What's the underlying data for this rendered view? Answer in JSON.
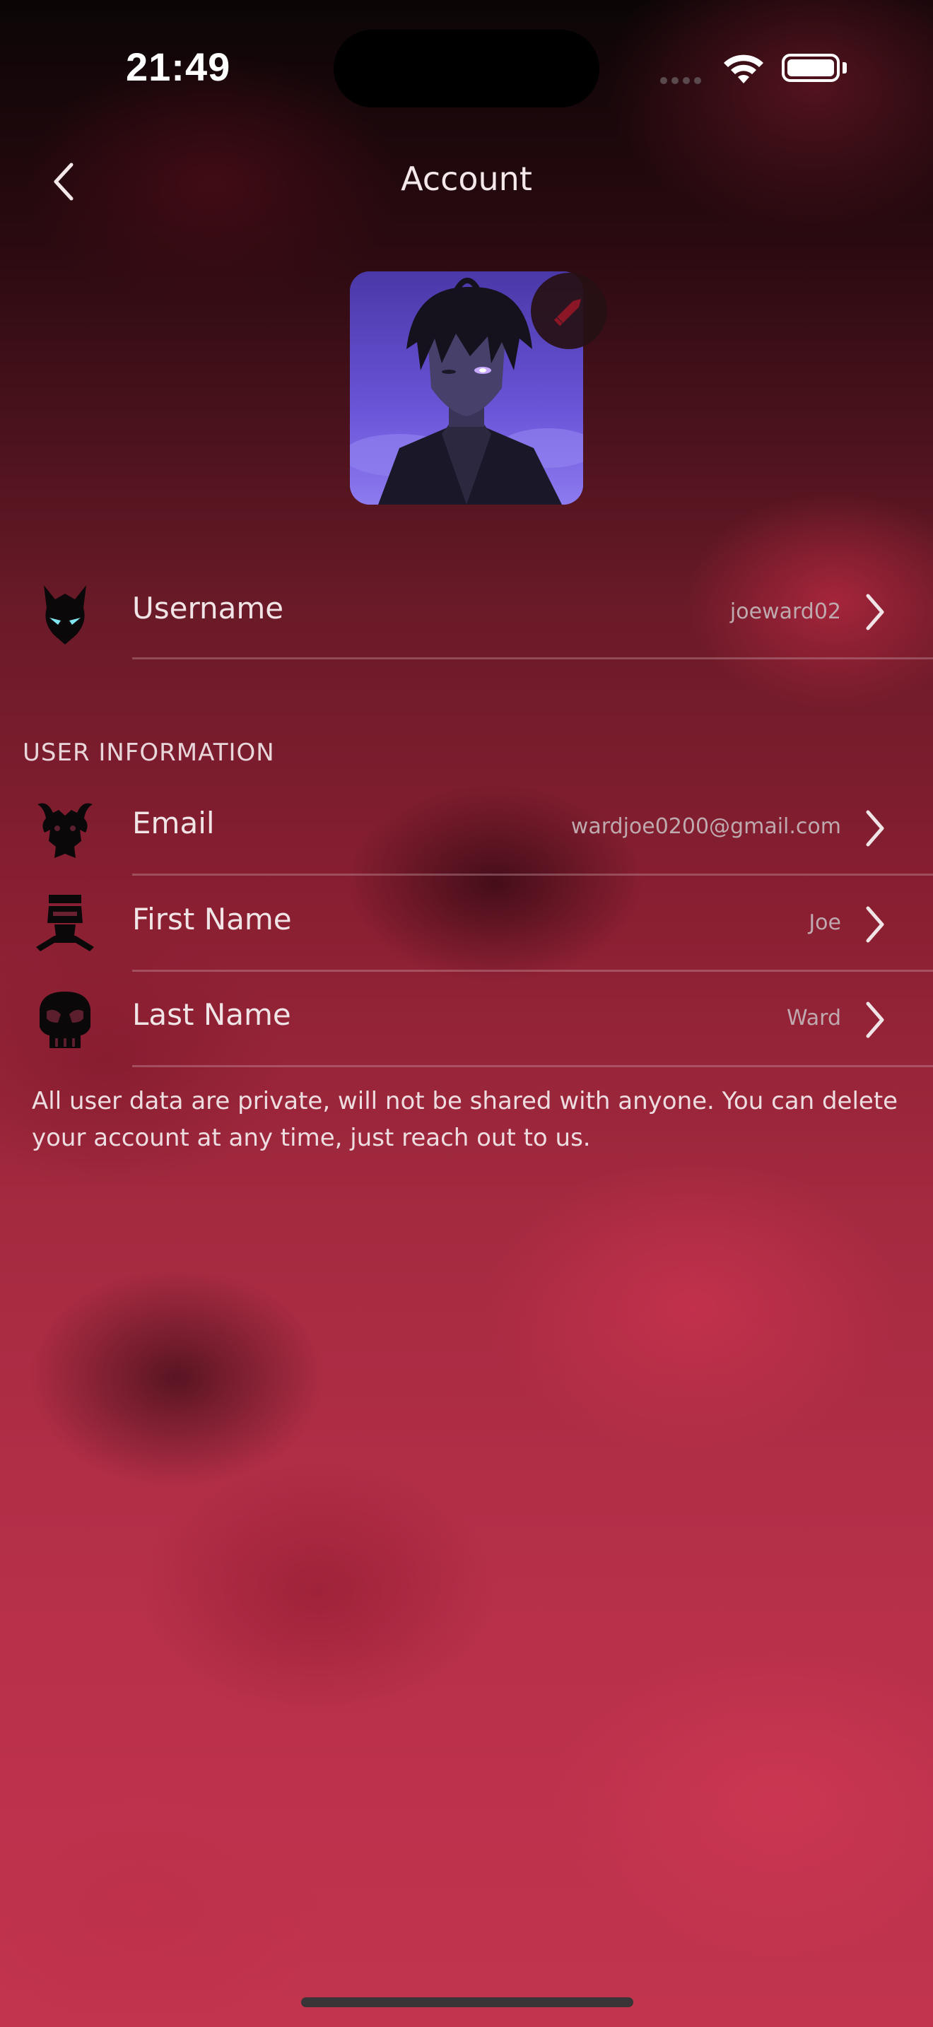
{
  "status_bar": {
    "time": "21:49"
  },
  "nav": {
    "title": "Account"
  },
  "profile": {
    "avatar_icon": "anime-character-portrait",
    "edit_icon": "pencil-icon"
  },
  "username_row": {
    "label": "Username",
    "value": "joeward02",
    "icon": "demon-head-icon"
  },
  "user_information": {
    "header": "USER INFORMATION",
    "rows": [
      {
        "label": "Email",
        "value": "wardjoe0200@gmail.com",
        "icon": "bull-demon-emblem-icon"
      },
      {
        "label": "First Name",
        "value": "Joe",
        "icon": "masked-ninja-icon"
      },
      {
        "label": "Last Name",
        "value": "Ward",
        "icon": "skull-mask-icon"
      }
    ]
  },
  "footer_note": "All user data are private, will not be shared with anyone. You can delete your account at any time, just reach out to us.",
  "colors": {
    "background_top": "#0b0506",
    "background_bottom": "#c2344e",
    "edit_accent": "#8a1626",
    "avatar_bg": "#5a46c8"
  }
}
